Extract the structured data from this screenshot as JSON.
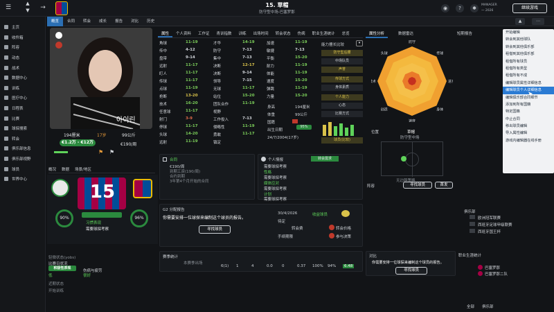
{
  "header": {
    "title": "15. 草帽",
    "subtitle": "防守型中场-巴塞罗那",
    "manager_lines": [
      "MANAGER",
      "一 2026"
    ],
    "continue_label": "继续游戏"
  },
  "sidebar": {
    "items": [
      "主页",
      "收件箱",
      "阵容",
      "动态",
      "战术",
      "数据中心",
      "训练",
      "医疗中心",
      "日程表",
      "比赛",
      "球探搜索",
      "转会",
      "俱乐部信息",
      "俱乐部视野",
      "球员",
      "世界中心"
    ]
  },
  "tabs": [
    "概览",
    "合同",
    "转会",
    "成长",
    "报告",
    "对比",
    "历史"
  ],
  "profile": {
    "photo_text": "아이린",
    "height": "194厘米",
    "age": "17岁",
    "weight": "99公斤",
    "value": "€1.2万 - €12万",
    "wage": "€190/周",
    "side_tabs": [
      "概况",
      "数据",
      "场景/地区"
    ],
    "shirt_number": "15",
    "ring_left": "90%",
    "ring_right": "96%",
    "status_label": "习惯表现",
    "report_label": "需要球探考察",
    "bottom_lines": [
      "轻微状态(yobs)",
      "积极性表现",
      "低",
      "良好"
    ],
    "bottom_small": [
      "比赛日状况",
      "伤病与疲劳",
      "低",
      "很好",
      "近期状态",
      "开始训练"
    ]
  },
  "attr_tabs": [
    "属性",
    "个人资料",
    "工作证",
    "青训指数",
    "训练",
    "出场时间",
    "转会状态",
    "伤病",
    "职业生涯统计",
    "总览"
  ],
  "attributes": [
    [
      [
        "角球",
        "11-19",
        "g"
      ],
      [
        "才华",
        "14-19",
        "g"
      ],
      [
        "加速",
        "11-19",
        "g"
      ]
    ],
    [
      [
        "传中",
        "4-12",
        "w"
      ],
      [
        "防守",
        "7-13",
        "w"
      ],
      [
        "敏捷",
        "7-13",
        "w"
      ]
    ],
    [
      [
        "盘带",
        "9-14",
        "w"
      ],
      [
        "集中",
        "7-13",
        "w"
      ],
      [
        "平衡",
        "15-20",
        "g"
      ]
    ],
    [
      [
        "远射",
        "11-17",
        "g"
      ],
      [
        "决断",
        "12-17",
        "y"
      ],
      [
        "耐力",
        "11-19",
        "g"
      ]
    ],
    [
      [
        "盯人",
        "11-17",
        "g"
      ],
      [
        "决断",
        "9-14",
        "w"
      ],
      [
        "体能",
        "11-19",
        "g"
      ]
    ],
    [
      [
        "传球",
        "11-17",
        "g"
      ],
      [
        "领导",
        "7-15",
        "w"
      ],
      [
        "速度",
        "15-20",
        "g"
      ]
    ],
    [
      [
        "点球",
        "11-19",
        "g"
      ],
      [
        "无球",
        "11-17",
        "g"
      ],
      [
        "弹跳",
        "11-19",
        "g"
      ]
    ],
    [
      [
        "抢断",
        "13-20",
        "y"
      ],
      [
        "站位",
        "15-20",
        "g"
      ],
      [
        "力量",
        "15-20",
        "g"
      ]
    ],
    [
      [
        "技术",
        "16-20",
        "g"
      ],
      [
        "团队合作",
        "11-19",
        "g"
      ],
      [
        "",
        "",
        ""
      ]
    ],
    [
      [
        "任意球",
        "11-17",
        "g"
      ],
      [
        "视野",
        "",
        "w"
      ],
      [
        "",
        "",
        ""
      ]
    ],
    [
      [
        "射门",
        "3-9",
        "r"
      ],
      [
        "工作投入",
        "7-13",
        "w"
      ],
      [
        "",
        "",
        ""
      ]
    ],
    [
      [
        "停球",
        "11-17",
        "g"
      ],
      [
        "侵略性",
        "11-19",
        "g"
      ],
      [
        "",
        "",
        ""
      ]
    ],
    [
      [
        "头球",
        "14-20",
        "g"
      ],
      [
        "勇敢",
        "11-17",
        "g"
      ],
      [
        "",
        "",
        ""
      ]
    ],
    [
      [
        "远射",
        "11-19",
        "g"
      ],
      [
        "镇定",
        "",
        "w"
      ],
      [
        "",
        "",
        ""
      ]
    ]
  ],
  "side_stats": {
    "labels": [
      "身高",
      "体重",
      "国籍",
      "出生日期"
    ],
    "values": [
      "194厘米",
      "99公斤",
      "",
      "24/7/2004(17岁)"
    ],
    "percent": "95%"
  },
  "roles": {
    "label": "能力擅长比较",
    "tags": [
      "防守型后腰",
      "中场队员",
      "声誉",
      "传球方式",
      "身体素质",
      "个人能力",
      "心态",
      "比赛方式"
    ],
    "button": "球员(比较)"
  },
  "contract": {
    "title": "合同",
    "lines": [
      "€190/周",
      "到期工资(190/周)",
      "合约到期",
      "3年第4个月开始的合同"
    ]
  },
  "personal": {
    "title": "个人情报",
    "lines": [
      "需要球探考察",
      "性格",
      "需要球探考察",
      "媒体应对",
      "需要球探考察",
      "计划",
      "需要球探考察"
    ],
    "badge": "转会需求"
  },
  "scout_report": {
    "title": "G2 分配报告",
    "text": "你需要安排一位球探来编制这个球员的报告。",
    "button": "寻找球员",
    "tags": [
      "待定",
      "转会费",
      "未来状况",
      "手续期限",
      "转会价格",
      "参与决策"
    ],
    "date": "30/4/2026",
    "right_title": "收益球员"
  },
  "season_stats": {
    "title": "赛季统计",
    "cols": [
      "本赛季出场",
      "",
      "",
      "",
      "",
      "",
      "",
      "",
      "",
      "",
      ""
    ],
    "row": [
      "6(1)",
      "1",
      "4",
      "0.0",
      "0",
      "0.37",
      "100%",
      "94%",
      "6.48"
    ]
  },
  "radar": {
    "tabs": [
      "属性分析",
      "数据雷达"
    ],
    "labels": [
      "防守",
      "传球",
      "进攻",
      "身体",
      "速度",
      "创造",
      "技术",
      "头球"
    ]
  },
  "position": {
    "title": "位置",
    "name": "草帽",
    "role": "防守型中场",
    "button": "寻找球员",
    "note": "无边路策略"
  },
  "team": {
    "label": "阵容",
    "select": "首发"
  },
  "compare": {
    "title": "对比",
    "text": "你需要安排一位球探来编制这个球员的报告。",
    "button": "寻找球员"
  },
  "right_panel": {
    "tab": "短期报告",
    "items": [
      "欧洲冠军联赛",
      "西班牙足球甲级联赛",
      "西班牙国王杯"
    ],
    "bottom_title": "职业生涯统计",
    "careers": [
      "巴塞罗那",
      "巴塞罗那二队"
    ],
    "total": "全部",
    "clubs": "俱乐部"
  },
  "menu": {
    "items": [
      "开始编辑",
      "转会到其他球队",
      "转会到其他俱乐部",
      "租借到其他俱乐部",
      "租借所有球员",
      "租借所有类型",
      "租借所有不成",
      "编辑球员属性详细信息",
      "编辑球员个人详细信息",
      "编辑俱乐部合同细节",
      "添加到所有国籍",
      "特定国籍",
      "中止合同",
      "移出球员编辑",
      "导入属性编辑",
      "游戏内编辑器在线手册"
    ],
    "highlight": 8
  }
}
